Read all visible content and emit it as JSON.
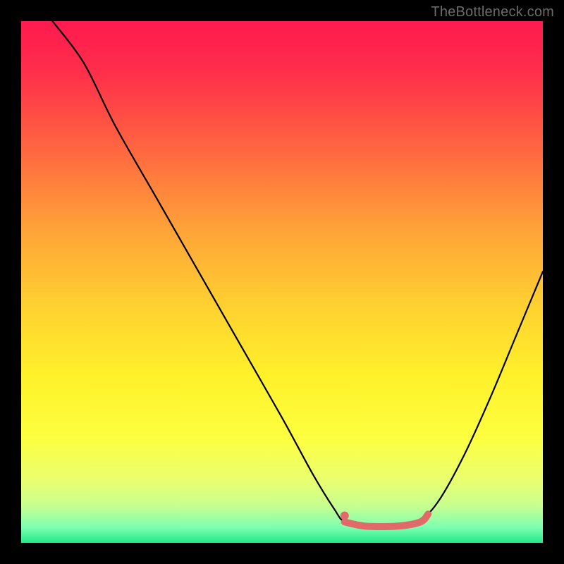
{
  "watermark": "TheBottleneck.com",
  "chart_data": {
    "type": "line",
    "title": "",
    "xlabel": "",
    "ylabel": "",
    "xlim": [
      0,
      100
    ],
    "ylim": [
      0,
      100
    ],
    "gradient_stops": [
      {
        "offset": 0.0,
        "color": "#ff1a4f"
      },
      {
        "offset": 0.1,
        "color": "#ff2f4a"
      },
      {
        "offset": 0.25,
        "color": "#ff6840"
      },
      {
        "offset": 0.4,
        "color": "#ffa338"
      },
      {
        "offset": 0.55,
        "color": "#ffd230"
      },
      {
        "offset": 0.68,
        "color": "#fff12a"
      },
      {
        "offset": 0.8,
        "color": "#fdff40"
      },
      {
        "offset": 0.88,
        "color": "#eaff70"
      },
      {
        "offset": 0.93,
        "color": "#c7ff90"
      },
      {
        "offset": 0.97,
        "color": "#7dffb0"
      },
      {
        "offset": 1.0,
        "color": "#22e78a"
      }
    ],
    "series": [
      {
        "name": "bottleneck-curve",
        "color": "#000000",
        "points": [
          {
            "x": 6.0,
            "y": 100.0
          },
          {
            "x": 12.0,
            "y": 92.0
          },
          {
            "x": 18.0,
            "y": 80.0
          },
          {
            "x": 26.0,
            "y": 66.0
          },
          {
            "x": 34.0,
            "y": 52.0
          },
          {
            "x": 42.0,
            "y": 38.0
          },
          {
            "x": 50.0,
            "y": 24.0
          },
          {
            "x": 56.0,
            "y": 13.0
          },
          {
            "x": 60.0,
            "y": 6.5
          },
          {
            "x": 62.0,
            "y": 4.0
          },
          {
            "x": 66.0,
            "y": 3.2
          },
          {
            "x": 72.0,
            "y": 3.2
          },
          {
            "x": 76.5,
            "y": 4.5
          },
          {
            "x": 80.0,
            "y": 8.0
          },
          {
            "x": 85.0,
            "y": 17.0
          },
          {
            "x": 90.0,
            "y": 28.0
          },
          {
            "x": 95.0,
            "y": 40.0
          },
          {
            "x": 100.0,
            "y": 52.0
          }
        ]
      },
      {
        "name": "highlight-segment",
        "color": "#e06a6a",
        "points": [
          {
            "x": 62.0,
            "y": 4.0
          },
          {
            "x": 66.0,
            "y": 3.2
          },
          {
            "x": 72.0,
            "y": 3.2
          },
          {
            "x": 76.5,
            "y": 4.0
          },
          {
            "x": 78.0,
            "y": 5.5
          }
        ]
      }
    ],
    "markers": [
      {
        "name": "highlight-dot",
        "x": 62.0,
        "y": 5.2,
        "color": "#e06a6a"
      }
    ]
  }
}
